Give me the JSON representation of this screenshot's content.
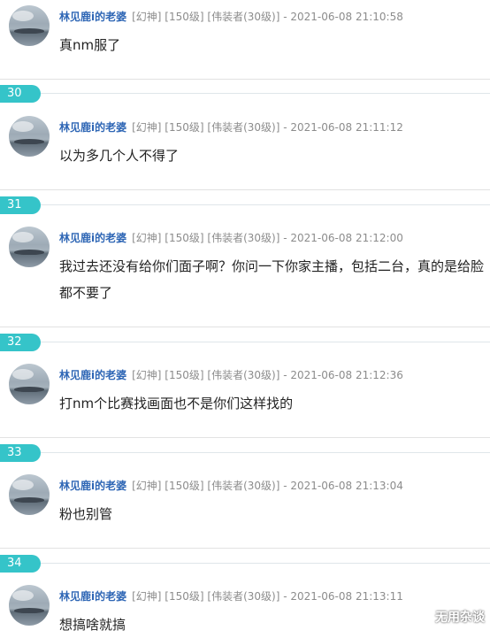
{
  "posts": [
    {
      "user": "林见鹿i的老婆",
      "tags": "[幻神] [150级] [伟装者(30级)]",
      "sep": "-",
      "time": "2021-06-08 21:10:58",
      "text": "真nm服了"
    },
    {
      "floor": "30",
      "user": "林见鹿i的老婆",
      "tags": "[幻神] [150级] [伟装者(30级)]",
      "sep": "-",
      "time": "2021-06-08 21:11:12",
      "text": "以为多几个人不得了"
    },
    {
      "floor": "31",
      "user": "林见鹿i的老婆",
      "tags": "[幻神] [150级] [伟装者(30级)]",
      "sep": "-",
      "time": "2021-06-08 21:12:00",
      "text": "我过去还没有给你们面子啊？你问一下你家主播，包括二台，真的是给脸都不要了"
    },
    {
      "floor": "32",
      "user": "林见鹿i的老婆",
      "tags": "[幻神] [150级] [伟装者(30级)]",
      "sep": "-",
      "time": "2021-06-08 21:12:36",
      "text": "打nm个比赛找画面也不是你们这样找的"
    },
    {
      "floor": "33",
      "user": "林见鹿i的老婆",
      "tags": "[幻神] [150级] [伟装者(30级)]",
      "sep": "-",
      "time": "2021-06-08 21:13:04",
      "text": "粉也别管"
    },
    {
      "floor": "34",
      "user": "林见鹿i的老婆",
      "tags": "[幻神] [150级] [伟装者(30级)]",
      "sep": "-",
      "time": "2021-06-08 21:13:11",
      "text": "想搞啥就搞"
    }
  ],
  "watermark": "无用杂谈"
}
